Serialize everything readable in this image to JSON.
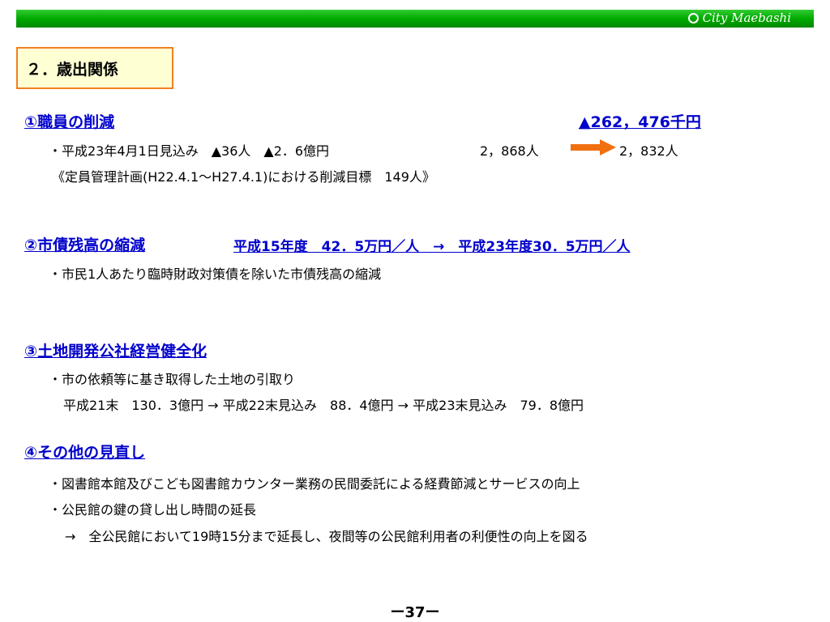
{
  "header": {
    "brand": "City Maebashi",
    "bar_color": "#00aa00"
  },
  "section_title": "２．歳出関係",
  "items": {
    "item1": {
      "title": "①職員の削減",
      "amount": "▲262，476千円",
      "line1_left": "・平成23年4月1日見込み　▲36人　▲2．6億円",
      "line1_from": "2，868人",
      "line1_to": "2，832人",
      "line2": "《定員管理計画(H22.4.1〜H27.4.1)における削減目標　149人》"
    },
    "item2": {
      "title": "②市債残高の縮減",
      "subtitle": "平成15年度　42．5万円／人　→　平成23年度30．5万円／人",
      "line1": "・市民1人あたり臨時財政対策債を除いた市債残高の縮減"
    },
    "item3": {
      "title": "③土地開発公社経営健全化",
      "line1": "・市の依頼等に基き取得した土地の引取り",
      "line2": "平成21末　130．3億円 → 平成22末見込み　88．4億円 → 平成23末見込み　79．8億円"
    },
    "item4": {
      "title": "④その他の見直し",
      "line1": "・図書館本館及びこども図書館カウンター業務の民間委託による経費節減とサービスの向上",
      "line2": "・公民館の鍵の貸し出し時間の延長",
      "line3": "→　全公民館において19時15分まで延長し、夜間等の公民館利用者の利便性の向上を図る"
    }
  },
  "page_number": "ー37ー",
  "colors": {
    "title_blue": "#0000cc",
    "box_border": "#f08020",
    "box_fill": "#ffffd4",
    "arrow": "#f07010"
  }
}
